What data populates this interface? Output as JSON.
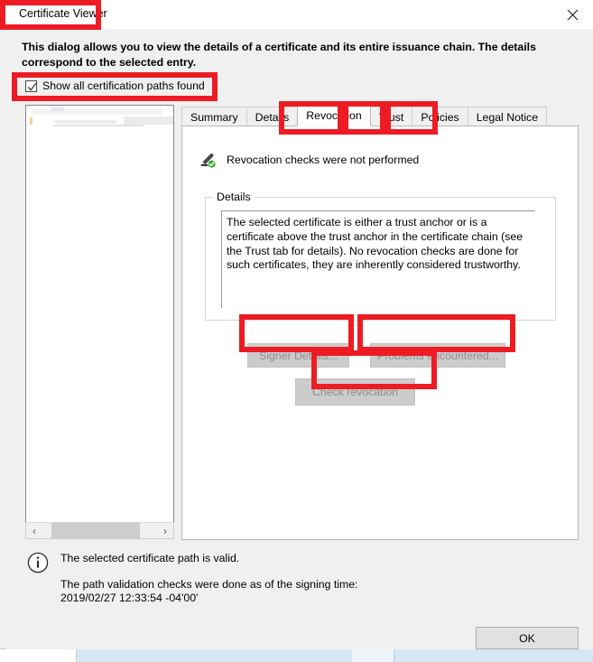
{
  "window": {
    "title": "Certificate Viewer",
    "close_icon": "close-icon"
  },
  "header": {
    "description": "This dialog allows you to view the details of a certificate and its entire issuance chain. The details correspond to the selected entry."
  },
  "options": {
    "show_all_paths_label": "Show all certification paths found",
    "show_all_paths_checked": "checked"
  },
  "cert_tree": {
    "scrollbar": {
      "left_arrow": "‹",
      "right_arrow": "›"
    }
  },
  "tabs": [
    {
      "label": "Summary",
      "active": false
    },
    {
      "label": "Details",
      "active": false
    },
    {
      "label": "Revocation",
      "active": true
    },
    {
      "label": "Trust",
      "active": false
    },
    {
      "label": "Policies",
      "active": false
    },
    {
      "label": "Legal Notice",
      "active": false
    }
  ],
  "revocation": {
    "status_text": "Revocation checks were not performed",
    "status_icon": "stamp-check-icon",
    "details_legend": "Details",
    "details_text": "The selected certificate is either a trust anchor or is a certificate above the trust anchor in the certificate chain (see the Trust tab for details). No revocation checks are done for such certificates, they are inherently considered trustworthy.",
    "buttons": {
      "signer_details": "Signer Details...",
      "problems_encountered": "Problems encountered...",
      "check_revocation": "Check revocation"
    }
  },
  "footer": {
    "info_icon": "info-icon",
    "line1": "The selected certificate path is valid.",
    "line2": "The path validation checks were done as of the signing time:",
    "line3": "2019/02/27 12:33:54 -04'00'"
  },
  "actions": {
    "ok_label": "OK"
  },
  "colors": {
    "annotation_red": "#ED1C24",
    "dialog_bg": "#F0F0F0",
    "panel_bg": "#FFFFFF",
    "disabled_button_bg": "#CCCCCC",
    "disabled_text": "#8C8C8C",
    "status_check_green": "#3BA935"
  }
}
